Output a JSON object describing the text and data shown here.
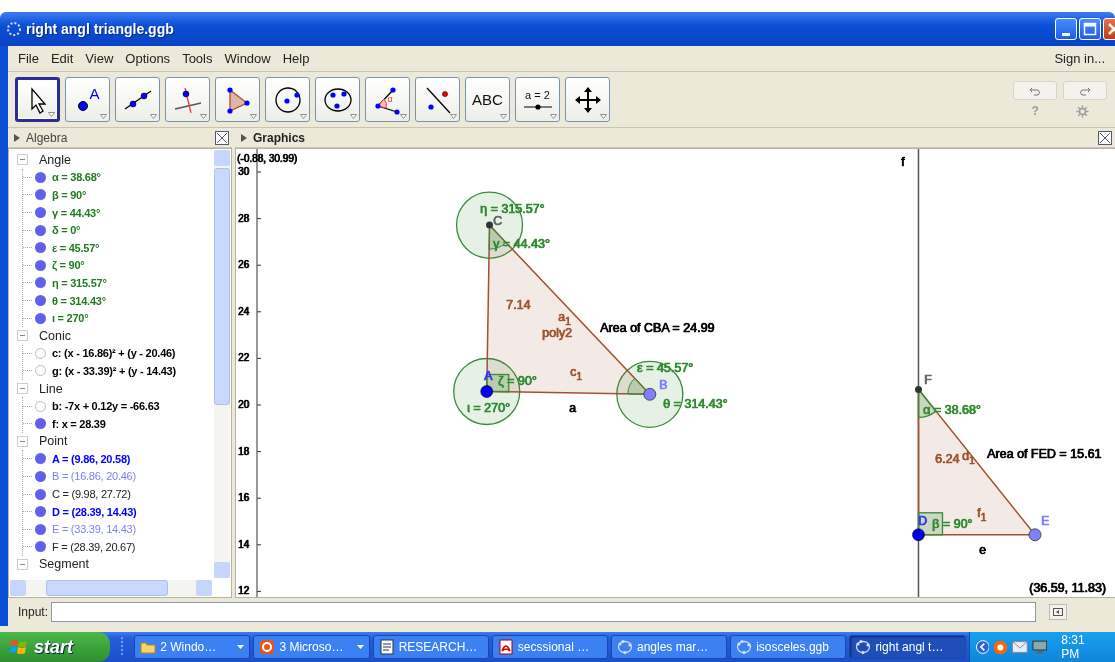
{
  "window": {
    "title": "right angl triangle.ggb"
  },
  "menu": [
    "File",
    "Edit",
    "View",
    "Options",
    "Tools",
    "Window",
    "Help"
  ],
  "sign_in": "Sign in...",
  "tools": [
    {
      "kind": "move",
      "selected": true
    },
    {
      "kind": "point",
      "label": "A",
      "selected": false
    },
    {
      "kind": "line",
      "selected": false
    },
    {
      "kind": "perpendicular",
      "selected": false
    },
    {
      "kind": "polygon",
      "selected": false
    },
    {
      "kind": "circle",
      "selected": false
    },
    {
      "kind": "conic",
      "selected": false
    },
    {
      "kind": "angle",
      "label": "α",
      "selected": false
    },
    {
      "kind": "reflect",
      "selected": false
    },
    {
      "kind": "text",
      "label": "ABC",
      "selected": false
    },
    {
      "kind": "slider",
      "label": "a = 2",
      "selected": false
    },
    {
      "kind": "move_view",
      "selected": false
    }
  ],
  "help": "?",
  "algebra": {
    "title": "Algebra",
    "groups": [
      {
        "name": "Angle",
        "expanded": true,
        "children": [
          {
            "text": "α = 38.68°",
            "shown": true,
            "bold": true,
            "color": "#217a21"
          },
          {
            "text": "β = 90°",
            "shown": true,
            "bold": true,
            "color": "#217a21"
          },
          {
            "text": "γ = 44.43°",
            "shown": true,
            "bold": true,
            "color": "#217a21"
          },
          {
            "text": "δ = 0°",
            "shown": true,
            "bold": true,
            "color": "#217a21"
          },
          {
            "text": "ε = 45.57°",
            "shown": true,
            "bold": true,
            "color": "#217a21"
          },
          {
            "text": "ζ = 90°",
            "shown": true,
            "bold": true,
            "color": "#217a21"
          },
          {
            "text": "η = 315.57°",
            "shown": true,
            "bold": true,
            "color": "#217a21"
          },
          {
            "text": "θ = 314.43°",
            "shown": true,
            "bold": true,
            "color": "#217a21"
          },
          {
            "text": "ι = 270°",
            "shown": true,
            "bold": true,
            "color": "#217a21"
          }
        ]
      },
      {
        "name": "Conic",
        "expanded": true,
        "children": [
          {
            "text": "c: (x - 16.86)² + (y - 20.46)",
            "shown": false,
            "bold": true,
            "color": "#000000"
          },
          {
            "text": "g: (x - 33.39)² + (y - 14.43)",
            "shown": false,
            "bold": true,
            "color": "#000000"
          }
        ]
      },
      {
        "name": "Line",
        "expanded": true,
        "children": [
          {
            "text": "b: -7x + 0.12y = -66.63",
            "shown": false,
            "bold": true,
            "color": "#000000"
          },
          {
            "text": "f: x = 28.39",
            "shown": true,
            "bold": true,
            "color": "#000000"
          }
        ]
      },
      {
        "name": "Point",
        "expanded": true,
        "children": [
          {
            "text": "A = (9.86, 20.58)",
            "shown": true,
            "bold": true,
            "color": "#0000ff"
          },
          {
            "text": "B = (16.86, 20.46)",
            "shown": true,
            "bold": false,
            "color": "#7d7dff"
          },
          {
            "text": "C = (9.98, 27.72)",
            "shown": true,
            "bold": false,
            "color": "#222222"
          },
          {
            "text": "D = (28.39, 14.43)",
            "shown": true,
            "bold": true,
            "color": "#0000ff"
          },
          {
            "text": "E = (33.39, 14.43)",
            "shown": true,
            "bold": false,
            "color": "#7d7dff"
          },
          {
            "text": "F = (28.39, 20.67)",
            "shown": true,
            "bold": false,
            "color": "#222222"
          }
        ]
      },
      {
        "name": "Segment",
        "expanded": true
      }
    ]
  },
  "graphics": {
    "title": "Graphics",
    "corner": "(-0.88, 30.99)",
    "yticks": [
      "30",
      "28",
      "26",
      "24",
      "22",
      "20",
      "18",
      "16",
      "14",
      "12"
    ],
    "labels": [
      {
        "text": "η = 315.57°",
        "color": "#2e8b2e"
      },
      {
        "text": "C",
        "color": "#666666"
      },
      {
        "text": "γ = 44.43°",
        "color": "#2e8b2e"
      },
      {
        "text": "7.14",
        "color": "#a0522d"
      },
      {
        "text": "a$_{1}$",
        "color": "#a0522d"
      },
      {
        "text": "poly2",
        "color": "#a0522d"
      },
      {
        "text": "Area of  CBA = 24.99",
        "color": "#000000"
      },
      {
        "text": "A",
        "color": "#3333ff"
      },
      {
        "text": "ζ = 90°",
        "color": "#2e8b2e"
      },
      {
        "text": "c$_{1}$",
        "color": "#a0522d"
      },
      {
        "text": "ε = 45.57°",
        "color": "#2e8b2e"
      },
      {
        "text": "B",
        "color": "#7d7dff"
      },
      {
        "text": "ι = 270°",
        "color": "#2e8b2e"
      },
      {
        "text": "θ = 314.43°",
        "color": "#2e8b2e"
      },
      {
        "text": "a",
        "color": "#000000"
      },
      {
        "text": "f",
        "color": "#000000"
      },
      {
        "text": "F",
        "color": "#666666"
      },
      {
        "text": "α = 38.68°",
        "color": "#2e8b2e"
      },
      {
        "text": "6.24",
        "color": "#a0522d"
      },
      {
        "text": "d$_{1}$",
        "color": "#a0522d"
      },
      {
        "text": "Area of  FED = 15.61",
        "color": "#000000"
      },
      {
        "text": "D",
        "color": "#3333ff"
      },
      {
        "text": "β = 90°",
        "color": "#2e8b2e"
      },
      {
        "text": "f$_{1}$",
        "color": "#a0522d"
      },
      {
        "text": "E",
        "color": "#7d7dff"
      },
      {
        "text": "e",
        "color": "#000000"
      },
      {
        "text": "(36.59, 11.83)",
        "color": "#000000"
      }
    ]
  },
  "input": {
    "label": "Input:"
  },
  "taskbar": {
    "start": "start",
    "tasks": [
      {
        "label": "2 Windo…",
        "kind": "folder",
        "menu": true,
        "selected": false
      },
      {
        "label": "3 Microso…",
        "kind": "office",
        "menu": true,
        "selected": false
      },
      {
        "label": "RESEARCH…",
        "kind": "doc",
        "menu": false,
        "selected": false
      },
      {
        "label": "secssional …",
        "kind": "pdf",
        "menu": false,
        "selected": false
      },
      {
        "label": "angles mar…",
        "kind": "ggb",
        "menu": false,
        "selected": false
      },
      {
        "label": "isosceles.ggb",
        "kind": "ggb",
        "menu": false,
        "selected": false
      },
      {
        "label": "right angl t…",
        "kind": "ggb",
        "menu": false,
        "selected": true
      }
    ],
    "time": "8:31 PM"
  }
}
